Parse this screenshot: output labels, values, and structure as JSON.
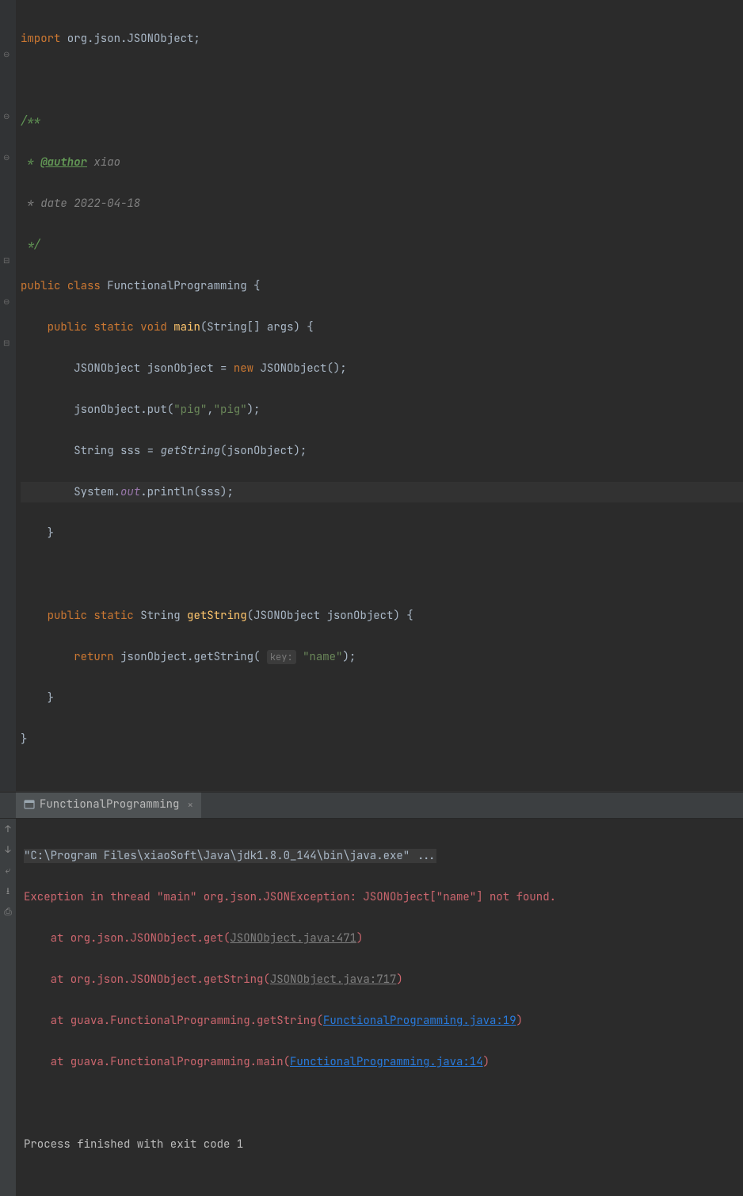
{
  "code": {
    "import_kw": "import",
    "import_pkg": " org.json.JSONObject",
    "jdoc_open": "/**",
    "jdoc_author_star": " * ",
    "jdoc_author_tag": "@author",
    "jdoc_author_name": " xiao",
    "jdoc_date": " * date 2022-04-18",
    "jdoc_close": " */",
    "public": "public",
    "class_kw": "class",
    "class_name": "FunctionalProgramming",
    "static": "static",
    "void": "void",
    "main": "main",
    "string_arr": "String[] args",
    "jsonobj_type": "JSONObject",
    "var_jo": "jsonObject",
    "new": "new",
    "put": "put",
    "str_pig": "\"pig\"",
    "str_pig2": "\"pig\"",
    "string_type": "String",
    "var_sss": "sss",
    "getstring_call": "getString",
    "system": "System",
    "out": "out",
    "println": "println",
    "getstring_def": "getString",
    "param": "JSONObject jsonObject",
    "return": "return",
    "getstring_m": "getString",
    "key_hint": "key:",
    "str_name": "\"name\""
  },
  "tab": {
    "label": "FunctionalProgramming"
  },
  "console": {
    "cmd": "\"C:\\Program Files\\xiaoSoft\\Java\\jdk1.8.0_144\\bin\\java.exe\" ...",
    "exception": "Exception in thread \"main\" org.json.JSONException: JSONObject[\"name\"] not found.",
    "at1_pre": "    at org.json.JSONObject.get(",
    "at1_link": "JSONObject.java:471",
    "at2_pre": "    at org.json.JSONObject.getString(",
    "at2_link": "JSONObject.java:717",
    "at3_pre": "    at guava.FunctionalProgramming.getString(",
    "at3_link": "FunctionalProgramming.java:19",
    "at4_pre": "    at guava.FunctionalProgramming.main(",
    "at4_link": "FunctionalProgramming.java:14",
    "close_paren": ")",
    "exit": "Process finished with exit code 1"
  }
}
